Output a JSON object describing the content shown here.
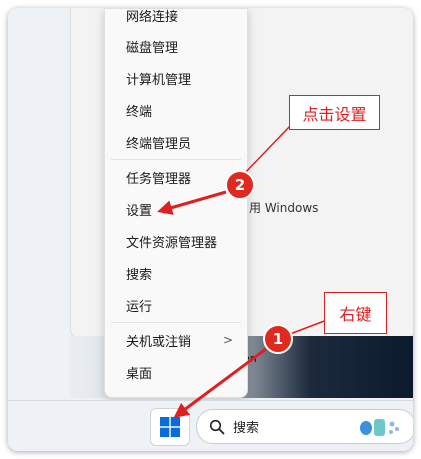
{
  "start_panel": {
    "partial_text": "用 Windows",
    "user_partial": "hen"
  },
  "context_menu": {
    "items": [
      {
        "label": "网络连接"
      },
      {
        "label": "磁盘管理"
      },
      {
        "label": "计算机管理"
      },
      {
        "label": "终端"
      },
      {
        "label": "终端管理员"
      },
      {
        "label": "任务管理器"
      },
      {
        "label": "设置"
      },
      {
        "label": "文件资源管理器"
      },
      {
        "label": "搜索"
      },
      {
        "label": "运行"
      },
      {
        "label": "关机或注销",
        "submenu_arrow": ">"
      },
      {
        "label": "桌面"
      }
    ]
  },
  "taskbar": {
    "search_label": "搜索"
  },
  "annotations": {
    "callout_settings": "点击设置",
    "callout_right_click": "右键",
    "badge_1": "1",
    "badge_2": "2",
    "color": "#e02020"
  },
  "colors": {
    "windows_blue": "#0a6cd8",
    "accent_red": "#e02a20"
  }
}
